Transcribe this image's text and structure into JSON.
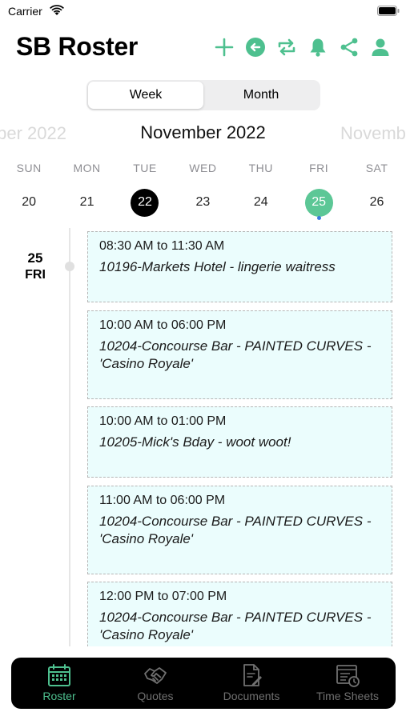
{
  "status_bar": {
    "carrier": "Carrier"
  },
  "header": {
    "title": "SB Roster",
    "actions": [
      "add-icon",
      "back-arrow-icon",
      "repeat-icon",
      "bell-icon",
      "share-icon",
      "user-icon"
    ],
    "accent_color": "#4ec08f"
  },
  "view_toggle": {
    "options": [
      "Week",
      "Month"
    ],
    "selected": "Week"
  },
  "calendar": {
    "prev_month": "ber 2022",
    "current_month": "November 2022",
    "next_month": "Novemb",
    "weekdays": [
      "SUN",
      "MON",
      "TUE",
      "WED",
      "THU",
      "FRI",
      "SAT"
    ],
    "dates": [
      "20",
      "21",
      "22",
      "23",
      "24",
      "25",
      "26"
    ],
    "today": "22",
    "selected": "25",
    "today_color": "#000000",
    "selected_color": "#5cc796"
  },
  "agenda": {
    "day_number": "25",
    "day_name": "FRI",
    "shifts": [
      {
        "time": "08:30 AM to 11:30 AM",
        "title": "10196-Markets Hotel - lingerie waitress"
      },
      {
        "time": "10:00 AM to 06:00 PM",
        "title": "10204-Concourse Bar - PAINTED CURVES - 'Casino Royale'"
      },
      {
        "time": "10:00 AM to 01:00 PM",
        "title": "10205-Mick's Bday - woot woot!"
      },
      {
        "time": "11:00 AM to 06:00 PM",
        "title": "10204-Concourse Bar - PAINTED CURVES - 'Casino Royale'"
      },
      {
        "time": "12:00 PM to 07:00 PM",
        "title": "10204-Concourse Bar - PAINTED CURVES - 'Casino Royale'"
      }
    ]
  },
  "tab_bar": {
    "tabs": [
      {
        "label": "Roster",
        "icon": "calendar-icon"
      },
      {
        "label": "Quotes",
        "icon": "handshake-icon"
      },
      {
        "label": "Documents",
        "icon": "document-pen-icon"
      },
      {
        "label": "Time Sheets",
        "icon": "timesheet-icon"
      }
    ],
    "active": "Roster"
  }
}
